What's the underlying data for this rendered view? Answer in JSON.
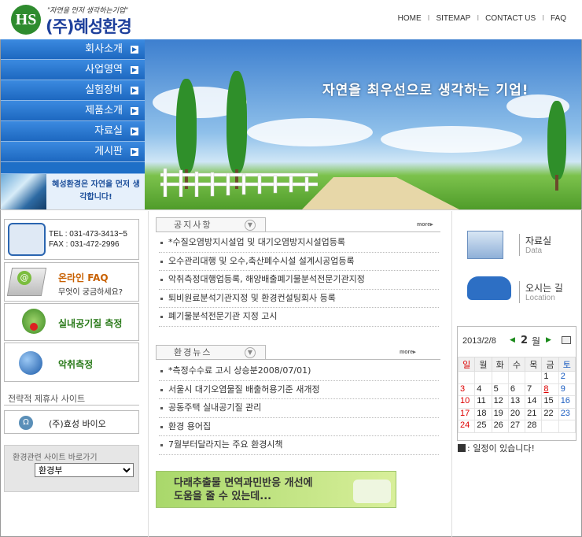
{
  "header": {
    "logo_mark": "HS",
    "slogan": "\"자연을 먼저 생각하는기업\"",
    "company_name": "(주)혜성환경",
    "nav": [
      "HOME",
      "SITEMAP",
      "CONTACT US",
      "FAQ"
    ],
    "nav_sep": "I"
  },
  "leftmenu": {
    "items": [
      "회사소개",
      "사업영역",
      "실험장비",
      "제품소개",
      "자료실",
      "게시판"
    ],
    "banner_text": "혜성환경은 자연을 먼저 생각합니다!"
  },
  "hero": {
    "text": "자연을 최우선으로 생각하는 기업!"
  },
  "contact": {
    "tel": "TEL : 031-473-3413~5",
    "fax": "FAX : 031-472-2996"
  },
  "faq": {
    "title": "온라인 FAQ",
    "subtitle": "무엇이 궁금하세요?"
  },
  "indoor_air": "실내공기질 측정",
  "odor": "악취측정",
  "partners": {
    "title": "전략적 제휴사 사이트",
    "item": "(주)효성 바이오"
  },
  "related_sites": {
    "title": "환경관련 사이트 바로가기",
    "selected": "환경부"
  },
  "notice": {
    "title": "공지사항",
    "more": "more▸",
    "items": [
      "*수질오염방지시설업 및 대기오염방지시설업등록",
      "오수관리대행 및 오수,축산폐수시설 설계시공업등록",
      "악취측정대행업등록, 해양배출폐기물분석전문기관지정",
      "퇴비원료분석기관지정 및 환경컨설팅회사 등록",
      "폐기물분석전문기관 지정 고시"
    ]
  },
  "env_news": {
    "title": "환경뉴스",
    "more": "more▸",
    "items": [
      "*측정수수료 고시 상승분2008/07/01)",
      "서울시 대기오염물질 배출허용기준 새개정",
      "공동주택 실내공기질 관리",
      "환경 용어집",
      "7월부터달라지는 주요 환경시책"
    ]
  },
  "ad": {
    "line1": "다래추출물 면역과민반응 개선에",
    "line2": "도움을 줄 수 있는데..."
  },
  "quick": {
    "data_title": "자료실",
    "data_sub": "Data",
    "loc_title": "오시는 길",
    "loc_sub": "Location"
  },
  "calendar": {
    "date": "2013/2/8",
    "prev": "◀",
    "month": "2",
    "month_unit": "월",
    "next": "▶",
    "weekdays": [
      "일",
      "월",
      "화",
      "수",
      "목",
      "금",
      "토"
    ],
    "weeks": [
      [
        "",
        "",
        "",
        "",
        "",
        "1",
        "2"
      ],
      [
        "3",
        "4",
        "5",
        "6",
        "7",
        "8",
        "9"
      ],
      [
        "10",
        "11",
        "12",
        "13",
        "14",
        "15",
        "16"
      ],
      [
        "17",
        "18",
        "19",
        "20",
        "21",
        "22",
        "23"
      ],
      [
        "24",
        "25",
        "26",
        "27",
        "28",
        "",
        ""
      ]
    ],
    "today": "8",
    "schedule": ": 일정이 있습니다!"
  },
  "colors": {
    "menu_blue": "#1d68c0",
    "logo_green": "#2e8b2e",
    "company_blue": "#1d3f9b",
    "accent_orange": "#c86000",
    "accent_green": "#2a7a1a"
  }
}
